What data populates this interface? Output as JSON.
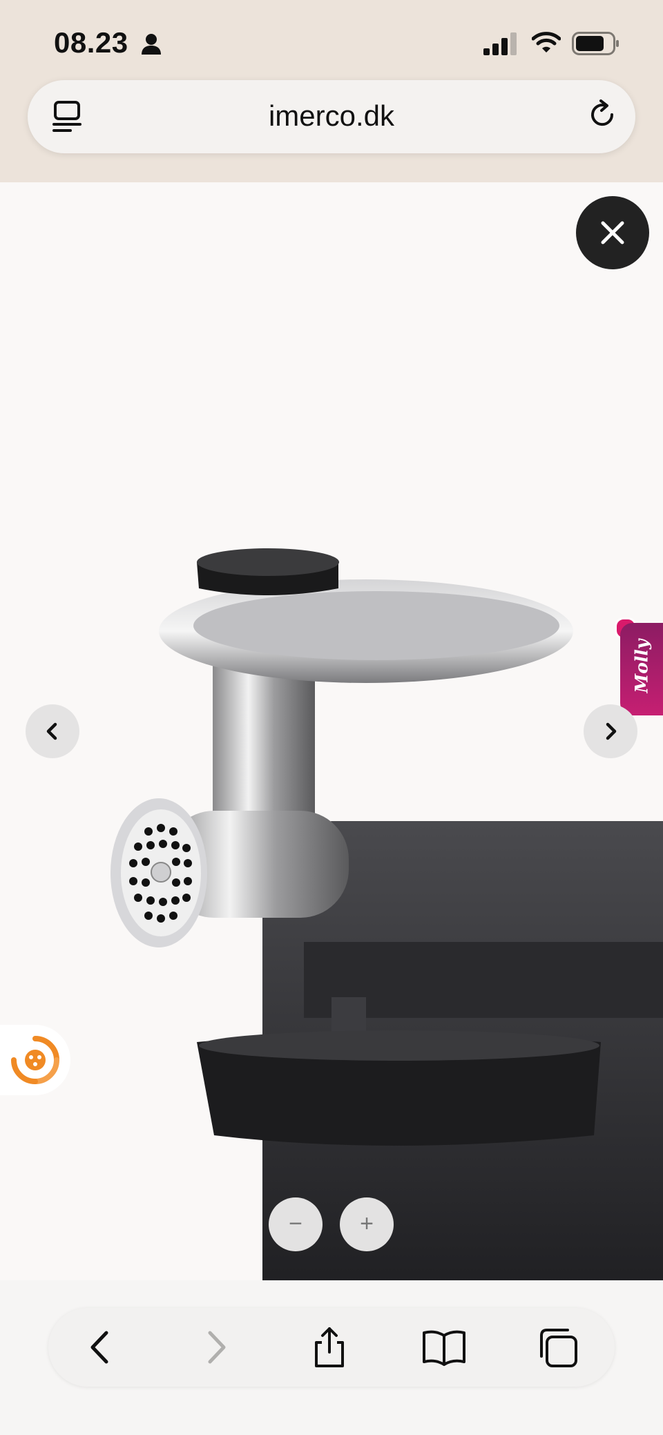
{
  "status_bar": {
    "time": "08.23",
    "icons": [
      "person-icon",
      "signal-icon",
      "wifi-icon",
      "battery-icon"
    ]
  },
  "browser": {
    "url": "imerco.dk",
    "icons": [
      "tabs-menu-icon",
      "reload-icon"
    ]
  },
  "viewer": {
    "molly_label": "Molly",
    "zoom_out_label": "−",
    "zoom_in_label": "+",
    "icons": [
      "close-icon",
      "chevron-left-icon",
      "chevron-right-icon",
      "chat-icon"
    ],
    "colors": {
      "molly": "#c21f70",
      "close_bg": "#222222",
      "chat_accent": "#f08a24"
    }
  },
  "toolbar": {
    "icons": [
      "back-icon",
      "forward-icon",
      "share-icon",
      "bookmarks-icon",
      "tabs-icon"
    ]
  }
}
